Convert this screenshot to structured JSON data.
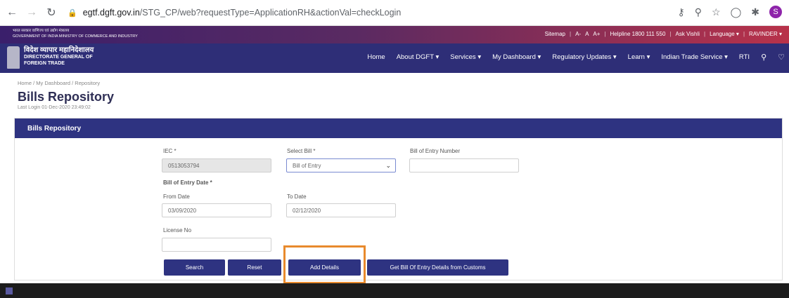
{
  "browser": {
    "url_host": "egtf.dgft.gov.in",
    "url_path": "/STG_CP/web?requestType=ApplicationRH&actionVal=checkLogin",
    "avatar_letter": "S"
  },
  "gov_strip": {
    "left_line1": "भारत सरकार  वाणिज्य एवं उद्योग मंत्रालय",
    "left_line2": "GOVERNMENT OF INDIA  MINISTRY OF COMMERCE AND INDUSTRY",
    "right_items": [
      "Sitemap",
      "A-",
      "A",
      "A+",
      "Helpline 1800 111 550",
      "Ask Vishli",
      "Language ▾",
      "RAVINDER ▾"
    ]
  },
  "header": {
    "logo_hindi": "विदेश व्यापार महानिदेशालय",
    "logo_line1": "DIRECTORATE GENERAL OF",
    "logo_line2": "FOREIGN TRADE",
    "menu": [
      "Home",
      "About DGFT ▾",
      "Services ▾",
      "My Dashboard ▾",
      "Regulatory Updates ▾",
      "Learn ▾",
      "Indian Trade Service ▾",
      "RTI"
    ]
  },
  "page": {
    "breadcrumb": "Home  /  My Dashboard  /  Repository",
    "title": "Bills Repository",
    "last_login": "Last Login 01-Dec-2020 23:49:02"
  },
  "panel": {
    "heading": "Bills Repository",
    "iec_label": "IEC *",
    "iec_value": "0513053794",
    "select_bill_label": "Select Bill *",
    "select_bill_value": "Bill of Entry",
    "boe_number_label": "Bill of Entry Number",
    "boe_number_value": "",
    "boe_date_label": "Bill of Entry Date *",
    "from_date_label": "From Date",
    "from_date_value": "03/09/2020",
    "to_date_label": "To Date",
    "to_date_value": "02/12/2020",
    "license_label": "License No",
    "license_value": ""
  },
  "buttons": {
    "search": "Search",
    "reset": "Reset",
    "add_details": "Add Details",
    "get_boe": "Get Bill Of Entry Details from Customs"
  },
  "colors": {
    "nav_bg": "#2e2e77",
    "panel_head": "#2e3381",
    "highlight": "#e88a2d"
  }
}
